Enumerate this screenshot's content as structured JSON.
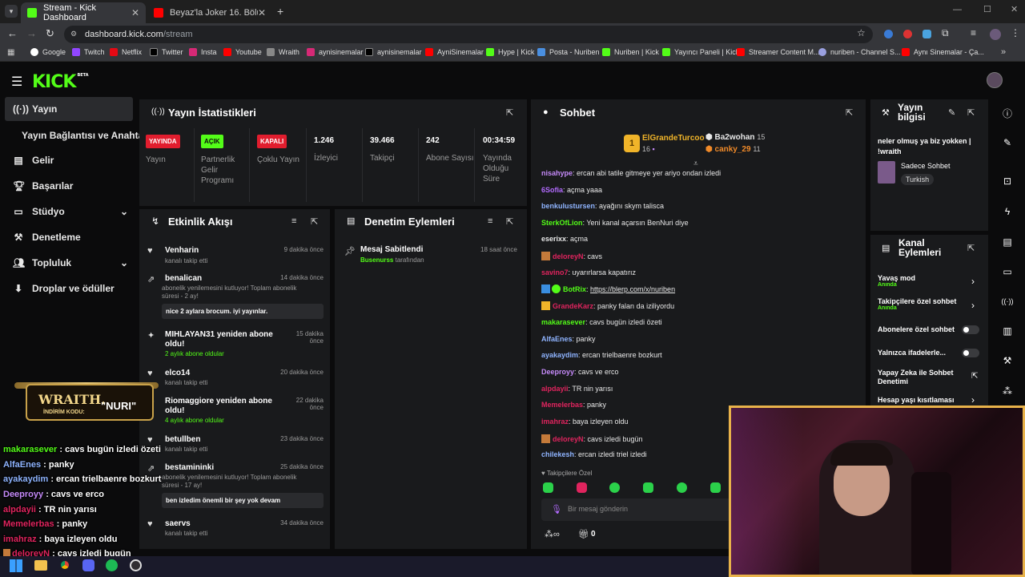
{
  "browser": {
    "tabs": [
      {
        "title": "Stream - Kick Dashboard",
        "active": true
      },
      {
        "title": "Beyaz'la Joker 16. Bölüm - YouT",
        "active": false
      }
    ],
    "url_domain": "dashboard.kick.com",
    "url_path": "/stream",
    "bookmarks": [
      "Google",
      "Twitch",
      "Netflix",
      "Twitter",
      "Insta",
      "Youtube",
      "Wraith",
      "aynisinemalar",
      "aynisinemalar",
      "AyniSinemalar",
      "Hype | Kick",
      "Posta - Nuriben",
      "Nuriben | Kick",
      "Yayıncı Paneli | Kick",
      "Streamer Content M...",
      "nuriben - Channel S...",
      "Aynı Sinemalar - Ça..."
    ]
  },
  "kick": {
    "logo": "KICK",
    "logo_tag": "BETA"
  },
  "sidebar": {
    "items": [
      {
        "label": "Yayın",
        "icon": "broadcast-icon"
      },
      {
        "label": "Yayın Bağlantısı ve Anahtarı",
        "icon": ""
      },
      {
        "label": "Gelir",
        "icon": "revenue-icon"
      },
      {
        "label": "Başarılar",
        "icon": "trophy-icon"
      },
      {
        "label": "Stüdyo",
        "icon": "studio-icon"
      },
      {
        "label": "Denetleme",
        "icon": "moderation-icon"
      },
      {
        "label": "Topluluk",
        "icon": "community-icon"
      },
      {
        "label": "Droplar ve ödüller",
        "icon": "drops-icon"
      }
    ]
  },
  "stats": {
    "title": "Yayın İstatistikleri",
    "cols": [
      {
        "badge": "YAYINDA",
        "label": "Yayın",
        "color": "#e11d2e"
      },
      {
        "badge": "AÇIK",
        "label": "Partnerlik Gelir Programı",
        "color": "#53fc18"
      },
      {
        "badge": "KAPALI",
        "label": "Çoklu Yayın",
        "color": "#e11d2e"
      },
      {
        "value": "1.246",
        "label": "İzleyici"
      },
      {
        "value": "39.466",
        "label": "Takipçi"
      },
      {
        "value": "242",
        "label": "Abone Sayısı"
      },
      {
        "value": "00:34:59",
        "label": "Yayında Olduğu Süre"
      }
    ]
  },
  "activity": {
    "title": "Etkinlik Akışı",
    "events": [
      {
        "name": "Venharin",
        "time": "9 dakika önce",
        "desc": "kanalı takip etti",
        "icon": "heart-icon"
      },
      {
        "name": "benalican",
        "time": "14 dakika önce",
        "desc": "abonelik yenilemesini kutluyor! Toplam abonelik süresi - 2 ay!",
        "msg": "nice 2 aylara brocum. iyi yayınlar.",
        "icon": "star-icon"
      },
      {
        "name": "MIHLAYAN31 yeniden abone oldu!",
        "time": "15 dakika önce",
        "desc": "2 aylık abone oldular",
        "icon": "sparkle-icon"
      },
      {
        "name": "elco14",
        "time": "20 dakika önce",
        "desc": "kanalı takip etti",
        "icon": "heart-icon"
      },
      {
        "name": "Riomaggiore yeniden abone oldu!",
        "time": "22 dakika önce",
        "desc": "4 aylık abone oldular",
        "icon": "sparkle-icon"
      },
      {
        "name": "betullben",
        "time": "23 dakika önce",
        "desc": "kanalı takip etti",
        "icon": "heart-icon"
      },
      {
        "name": "bestamininki",
        "time": "25 dakika önce",
        "desc": "abonelik yenilemesini kutluyor! Toplam abonelik süresi - 17 ay!",
        "msg": "ben izledim önemli bir şey yok devam",
        "icon": "star-icon"
      },
      {
        "name": "saervs",
        "time": "34 dakika önce",
        "desc": "kanalı takip etti",
        "icon": "heart-icon"
      }
    ]
  },
  "moderation": {
    "title": "Denetim Eylemleri",
    "item": {
      "name": "Mesaj Sabitlendi",
      "by": "Busenurss",
      "by_suffix": "tarafından",
      "time": "18 saat önce"
    }
  },
  "chat": {
    "title": "Sohbet",
    "top": [
      {
        "name": "ElGrandeTurcoo",
        "count": "16",
        "rank": "1"
      },
      {
        "name": "Ba2wohan",
        "count": "15"
      },
      {
        "name": "canky_29",
        "count": "11"
      }
    ],
    "messages": [
      {
        "user": "nisahype",
        "color": "#c58af9",
        "text": ": ercan abi tatile gitmeye yer ariyo ondan izledi"
      },
      {
        "user": "6Sofia",
        "color": "#b36bff",
        "text": ": açma yaaa"
      },
      {
        "user": "benkulustursen",
        "color": "#8fb4ff",
        "text": ": ayağını skym talisca"
      },
      {
        "user": "SterkOfLion",
        "color": "#53fc18",
        "text": ": Yeni kanal açarsın BenNuri diye"
      },
      {
        "user": "eserixx",
        "color": "#e8e8e8",
        "text": ": açma"
      },
      {
        "user": "deloreyN",
        "color": "#e0245e",
        "text": ": cavs"
      },
      {
        "user": "savino7",
        "color": "#e0245e",
        "text": ": uyarırlarsa kapatırız"
      },
      {
        "user": "BotRix",
        "color": "#53fc18",
        "text": ": ",
        "link": "https://blerp.com/x/nuriben"
      },
      {
        "user": "GrandeKarz",
        "color": "#e0245e",
        "text": ": panky falan da iziliyordu"
      },
      {
        "user": "makarasever",
        "color": "#53fc18",
        "text": ": cavs bugün izledi özeti"
      },
      {
        "user": "AlfaEnes",
        "color": "#8fb4ff",
        "text": ": panky"
      },
      {
        "user": "ayakaydim",
        "color": "#8fb4ff",
        "text": ": ercan trielbaenre bozkurt"
      },
      {
        "user": "Deeproyy",
        "color": "#c58af9",
        "text": ": cavs ve erco"
      },
      {
        "user": "alpdayii",
        "color": "#e0245e",
        "text": ": TR nin yarısı"
      },
      {
        "user": "Memelerbas",
        "color": "#e0245e",
        "text": ": panky"
      },
      {
        "user": "imahraz",
        "color": "#e0245e",
        "text": ": baya izleyen oldu"
      },
      {
        "user": "deloreyN",
        "color": "#e0245e",
        "text": ": cavs izledi bugün"
      },
      {
        "user": "chilekesh",
        "color": "#8fb4ff",
        "text": ": ercan izledi triel izledi"
      }
    ],
    "followers_only": "Takipçilere Özel",
    "input_placeholder": "Bir mesaj gönderin",
    "footer_count": "0"
  },
  "stream_info": {
    "title": "Yayın bilgisi",
    "stream_title": "neler olmuş ya biz yokken | !wraith",
    "category": "Sadece Sohbet",
    "tag": "Turkish"
  },
  "channel_actions": {
    "title": "Kanal Eylemleri",
    "items": [
      {
        "label": "Yavaş mod",
        "sub": "Anında",
        "kind": "chevron"
      },
      {
        "label": "Takipçilere özel sohbet",
        "sub": "Anında",
        "kind": "chevron"
      },
      {
        "label": "Abonelere özel sohbet",
        "kind": "toggle"
      },
      {
        "label": "Yalnızca ifadelerle...",
        "kind": "toggle"
      },
      {
        "label": "Yapay Zeka ile Sohbet Denetimi",
        "kind": "external"
      },
      {
        "label": "Hesap yaşı kısıtlaması",
        "kind": "chevron"
      }
    ]
  },
  "overlay": {
    "promo_brand": "WRAITH.",
    "promo_code_label": "İNDİRİM KODU:",
    "promo_code": "\"NURI\"",
    "chat_lines": [
      {
        "user": "makarasever",
        "text": " : cavs bugün izledi özeti",
        "color": "#53fc18"
      },
      {
        "user": "AlfaEnes",
        "text": " : panky",
        "color": "#8fb4ff"
      },
      {
        "user": "ayakaydim",
        "text": " : ercan trielbaenre bozkurt",
        "color": "#8fb4ff"
      },
      {
        "user": "Deeproyy",
        "text": " : cavs ve erco",
        "color": "#c58af9"
      },
      {
        "user": "alpdayii",
        "text": " : TR nin yarısı",
        "color": "#e0245e"
      },
      {
        "user": "Memelerbas",
        "text": " : panky",
        "color": "#e0245e"
      },
      {
        "user": "imahraz",
        "text": " : baya izleyen oldu",
        "color": "#e0245e"
      },
      {
        "user": "deloreyN",
        "text": " : cavs izledi bugün",
        "color": "#e0245e"
      }
    ]
  },
  "colors": {
    "accent": "#53fc18",
    "live": "#e11d2e",
    "webcam_border": "#e8b24a"
  }
}
